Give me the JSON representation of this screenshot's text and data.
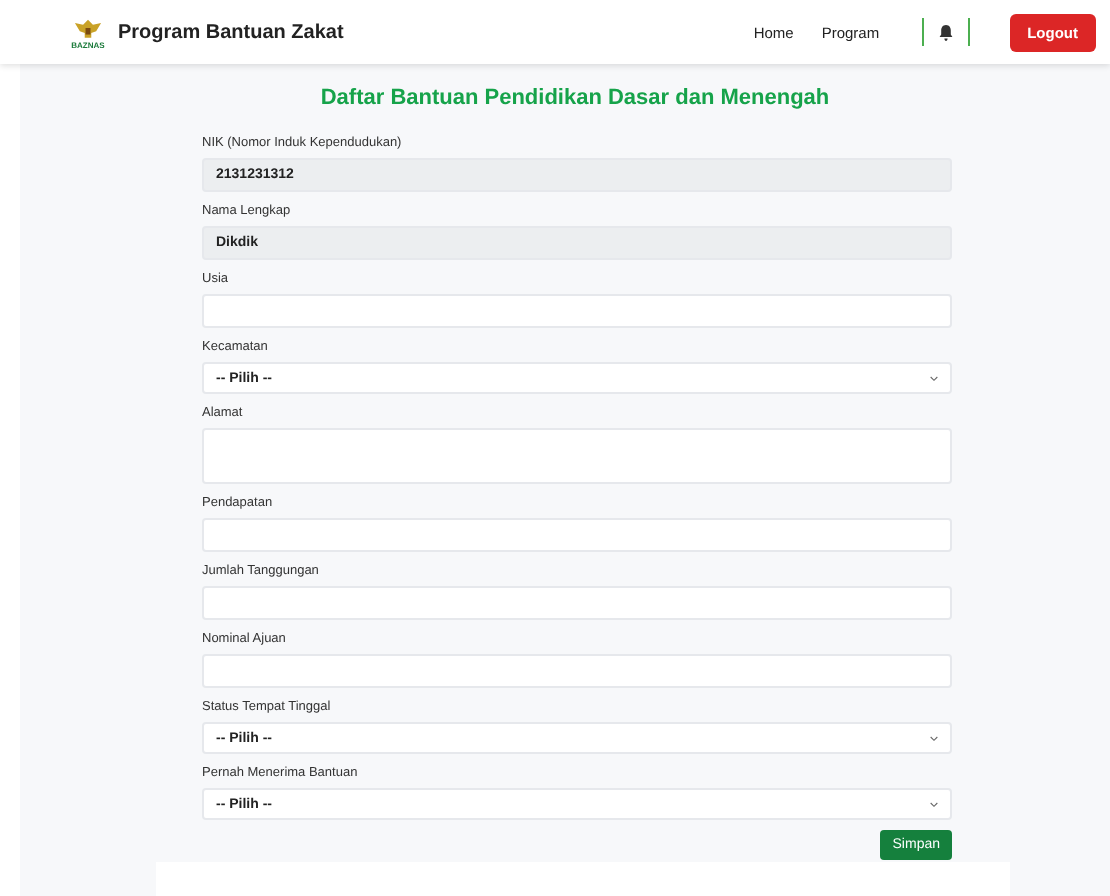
{
  "header": {
    "logo_caption": "BAZNAS",
    "title": "Program Bantuan Zakat",
    "nav": [
      {
        "label": "Home"
      },
      {
        "label": "Program"
      }
    ],
    "logout": "Logout"
  },
  "form": {
    "title": "Daftar Bantuan Pendidikan Dasar dan Menengah",
    "fields": [
      {
        "kind": "readonly",
        "label": "NIK (Nomor Induk Kependudukan)",
        "value": "2131231312"
      },
      {
        "kind": "readonly",
        "label": "Nama Lengkap",
        "value": "Dikdik"
      },
      {
        "kind": "text",
        "label": "Usia"
      },
      {
        "kind": "select",
        "label": "Kecamatan",
        "value": "-- Pilih --"
      },
      {
        "kind": "textarea",
        "label": "Alamat"
      },
      {
        "kind": "text",
        "label": "Pendapatan"
      },
      {
        "kind": "text",
        "label": "Jumlah Tanggungan"
      },
      {
        "kind": "text",
        "label": "Nominal Ajuan"
      },
      {
        "kind": "select",
        "label": "Status Tempat Tinggal",
        "value": "-- Pilih --"
      },
      {
        "kind": "select",
        "label": "Pernah Menerima Bantuan",
        "value": "-- Pilih --"
      }
    ],
    "submit": "Simpan"
  }
}
